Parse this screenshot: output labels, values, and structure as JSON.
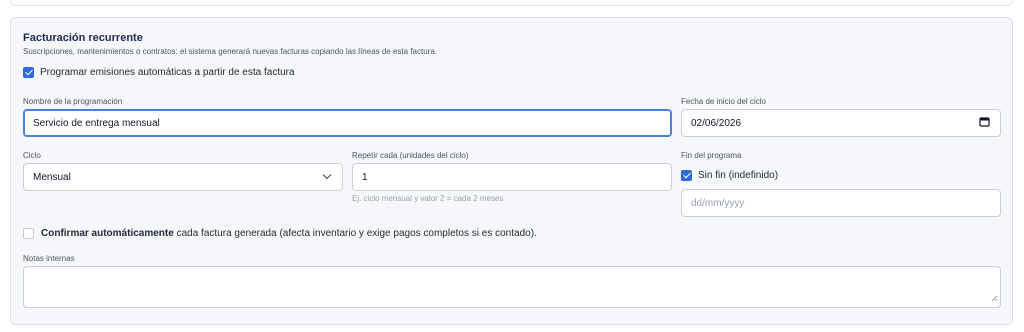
{
  "section": {
    "title": "Facturación recurrente",
    "subtitle": "Suscripciones, mantenimientos o contratos: el sistema generará nuevas facturas copiando las líneas de esta factura."
  },
  "schedule_toggle": {
    "label": "Programar emisiones automáticas a partir de esta factura",
    "checked": true
  },
  "name_field": {
    "label": "Nombre de la programación",
    "value": "Servicio de entrega mensual"
  },
  "start_date_field": {
    "label": "Fecha de inicio del ciclo",
    "value": "02/06/2026"
  },
  "cycle_field": {
    "label": "Ciclo",
    "value": "Mensual"
  },
  "repeat_field": {
    "label": "Repetir cada (unidades del ciclo)",
    "value": "1",
    "hint": "Ej. ciclo mensual y valor 2 = cada 2 meses"
  },
  "end_field": {
    "label": "Fin del programa",
    "no_end_label": "Sin fin (indefinido)",
    "no_end_checked": true,
    "date_placeholder": "dd/mm/yyyy"
  },
  "auto_confirm": {
    "bold_label": "Confirmar automáticamente",
    "rest_label": " cada factura generada (afecta inventario y exige pagos completos si es contado).",
    "checked": false
  },
  "notes_field": {
    "label": "Notas internas",
    "value": ""
  },
  "colors": {
    "accent": "#2f6bd8",
    "panel_bg": "#f5f7fb",
    "title": "#1e2a52"
  },
  "icons": {
    "checkbox_checked": "checkmark-icon",
    "select_arrow": "chevron-down-icon",
    "date_picker": "calendar-icon",
    "resize": "resize-handle-icon"
  }
}
